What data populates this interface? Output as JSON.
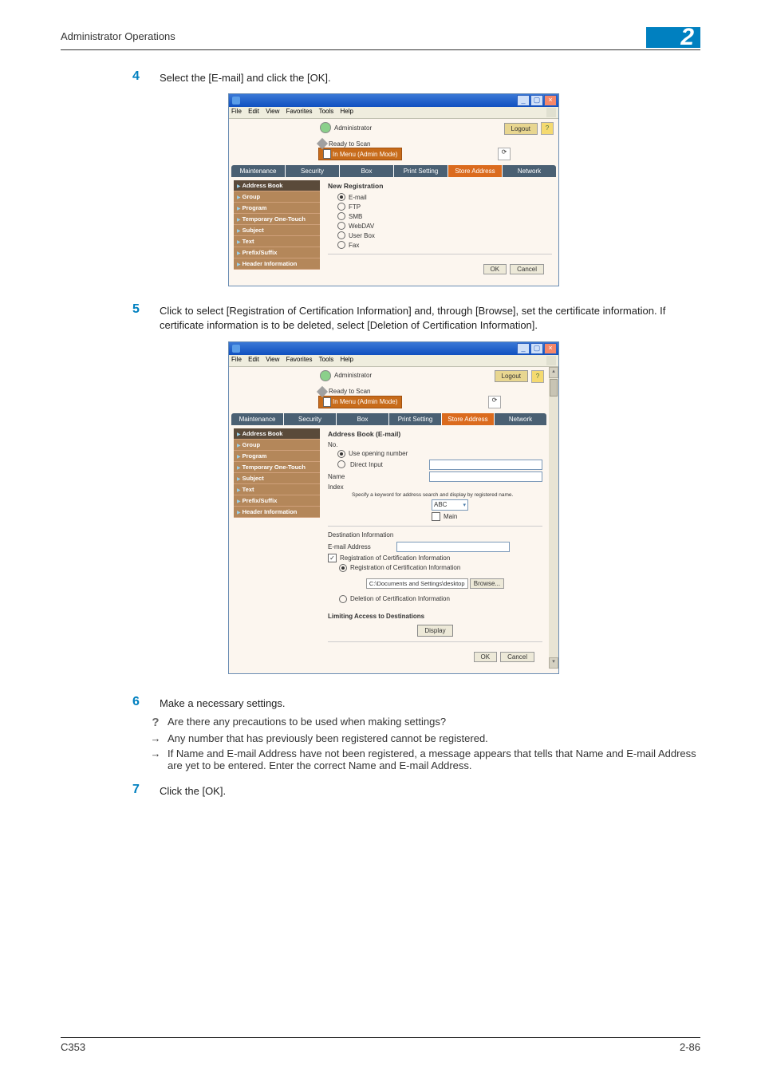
{
  "header": {
    "section_title": "Administrator Operations",
    "section_number": "2"
  },
  "step4": {
    "num": "4",
    "text": "Select the [E-mail] and click the [OK]."
  },
  "step5": {
    "num": "5",
    "text": "Click to select [Registration of Certification Information] and, through [Browse], set the certificate information. If certificate information is to be deleted, select [Deletion of Certification Information]."
  },
  "step6": {
    "num": "6",
    "text": "Make a necessary settings."
  },
  "q1": "Are there any precautions to be used when making settings?",
  "a1": "Any number that has previously been registered cannot be registered.",
  "a2": "If Name and E-mail Address have not been registered, a message appears that tells that Name and E-mail Address are yet to be entered. Enter the correct Name and E-mail Address.",
  "step7": {
    "num": "7",
    "text": "Click the [OK]."
  },
  "footer": {
    "model": "C353",
    "page": "2-86"
  },
  "menu": {
    "file": "File",
    "edit": "Edit",
    "view": "View",
    "fav": "Favorites",
    "tools": "Tools",
    "help": "Help"
  },
  "common": {
    "administrator": "Administrator",
    "logout": "Logout",
    "ready": "Ready to Scan",
    "mode": "In Menu (Admin Mode)",
    "ok": "OK",
    "cancel": "Cancel",
    "browse": "Browse...",
    "display": "Display"
  },
  "tabs": [
    "Maintenance",
    "Security",
    "Box",
    "Print Setting",
    "Store Address",
    "Network"
  ],
  "sidebar": [
    "Address Book",
    "Group",
    "Program",
    "Temporary One-Touch",
    "Subject",
    "Text",
    "Prefix/Suffix",
    "Header Information"
  ],
  "panel1": {
    "title": "New Registration",
    "opts": [
      "E-mail",
      "FTP",
      "SMB",
      "WebDAV",
      "User Box",
      "Fax"
    ]
  },
  "panel2": {
    "title": "Address Book (E-mail)",
    "no": "No.",
    "opt_open": "Use opening number",
    "opt_direct": "Direct Input",
    "name": "Name",
    "index": "Index",
    "hint": "Specify a keyword for address search and display by registered name.",
    "index_val": "ABC",
    "main": "Main",
    "section2": "Destination Information",
    "email": "E-mail Address",
    "reg_chk": "Registration of Certification Information",
    "reg_radio": "Registration of Certification Information",
    "path": "C:\\Documents and Settings\\desktop",
    "del_radio": "Deletion of Certification Information",
    "limit_title": "Limiting Access to Destinations"
  }
}
